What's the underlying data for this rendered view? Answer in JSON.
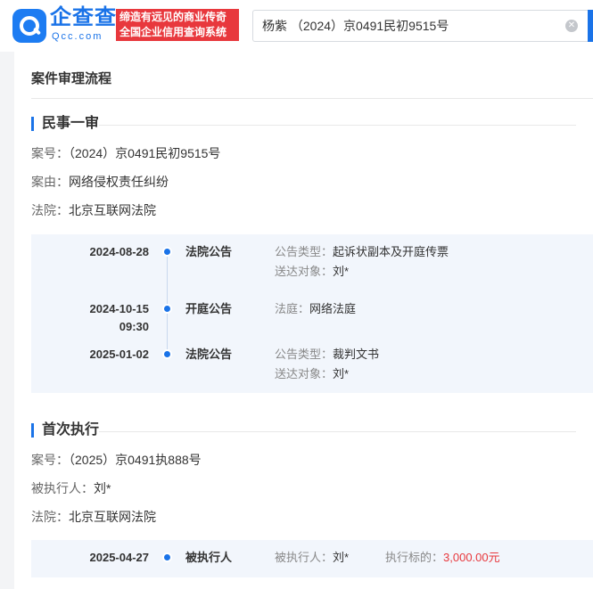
{
  "brand": {
    "name": "企查查",
    "domain": "Qcc.com",
    "slogan_line1": "缔造有远见的商业传奇",
    "slogan_line2": "全国企业信用查询系统"
  },
  "search": {
    "value": "杨紫 （2024）京0491民初9515号",
    "clear_icon": "clear-icon"
  },
  "page": {
    "section_title": "案件审理流程"
  },
  "cases": [
    {
      "title": "民事一审",
      "info": [
        {
          "label": "案号：",
          "value": "（2024）京0491民初9515号"
        },
        {
          "label": "案由：",
          "value": "网络侵权责任纠纷"
        },
        {
          "label": "法院：",
          "value": "北京互联网法院"
        }
      ],
      "events": [
        {
          "date": "2024-08-28",
          "time": "",
          "event": "法院公告",
          "details": [
            {
              "label": "公告类型：",
              "value": "起诉状副本及开庭传票"
            },
            {
              "label": "送达对象：",
              "value": "刘*"
            }
          ]
        },
        {
          "date": "2024-10-15",
          "time": "09:30",
          "event": "开庭公告",
          "details": [
            {
              "label": "法庭：",
              "value": "网络法庭"
            }
          ]
        },
        {
          "date": "2025-01-02",
          "time": "",
          "event": "法院公告",
          "details": [
            {
              "label": "公告类型：",
              "value": "裁判文书"
            },
            {
              "label": "送达对象：",
              "value": "刘*"
            }
          ]
        }
      ]
    },
    {
      "title": "首次执行",
      "info": [
        {
          "label": "案号：",
          "value": "（2025）京0491执888号"
        },
        {
          "label": "被执行人：",
          "value": "刘*"
        },
        {
          "label": "法院：",
          "value": "北京互联网法院"
        }
      ],
      "events": [
        {
          "date": "2025-04-27",
          "time": "",
          "event": "被执行人",
          "details": [
            {
              "label": "被执行人：",
              "value": "刘*"
            },
            {
              "label": "执行标的：",
              "value": "3,000.00元"
            }
          ]
        }
      ]
    }
  ],
  "colors": {
    "accent": "#1a73e8",
    "brand_red": "#e8383d",
    "timeline_bg": "#f2f6fc"
  }
}
